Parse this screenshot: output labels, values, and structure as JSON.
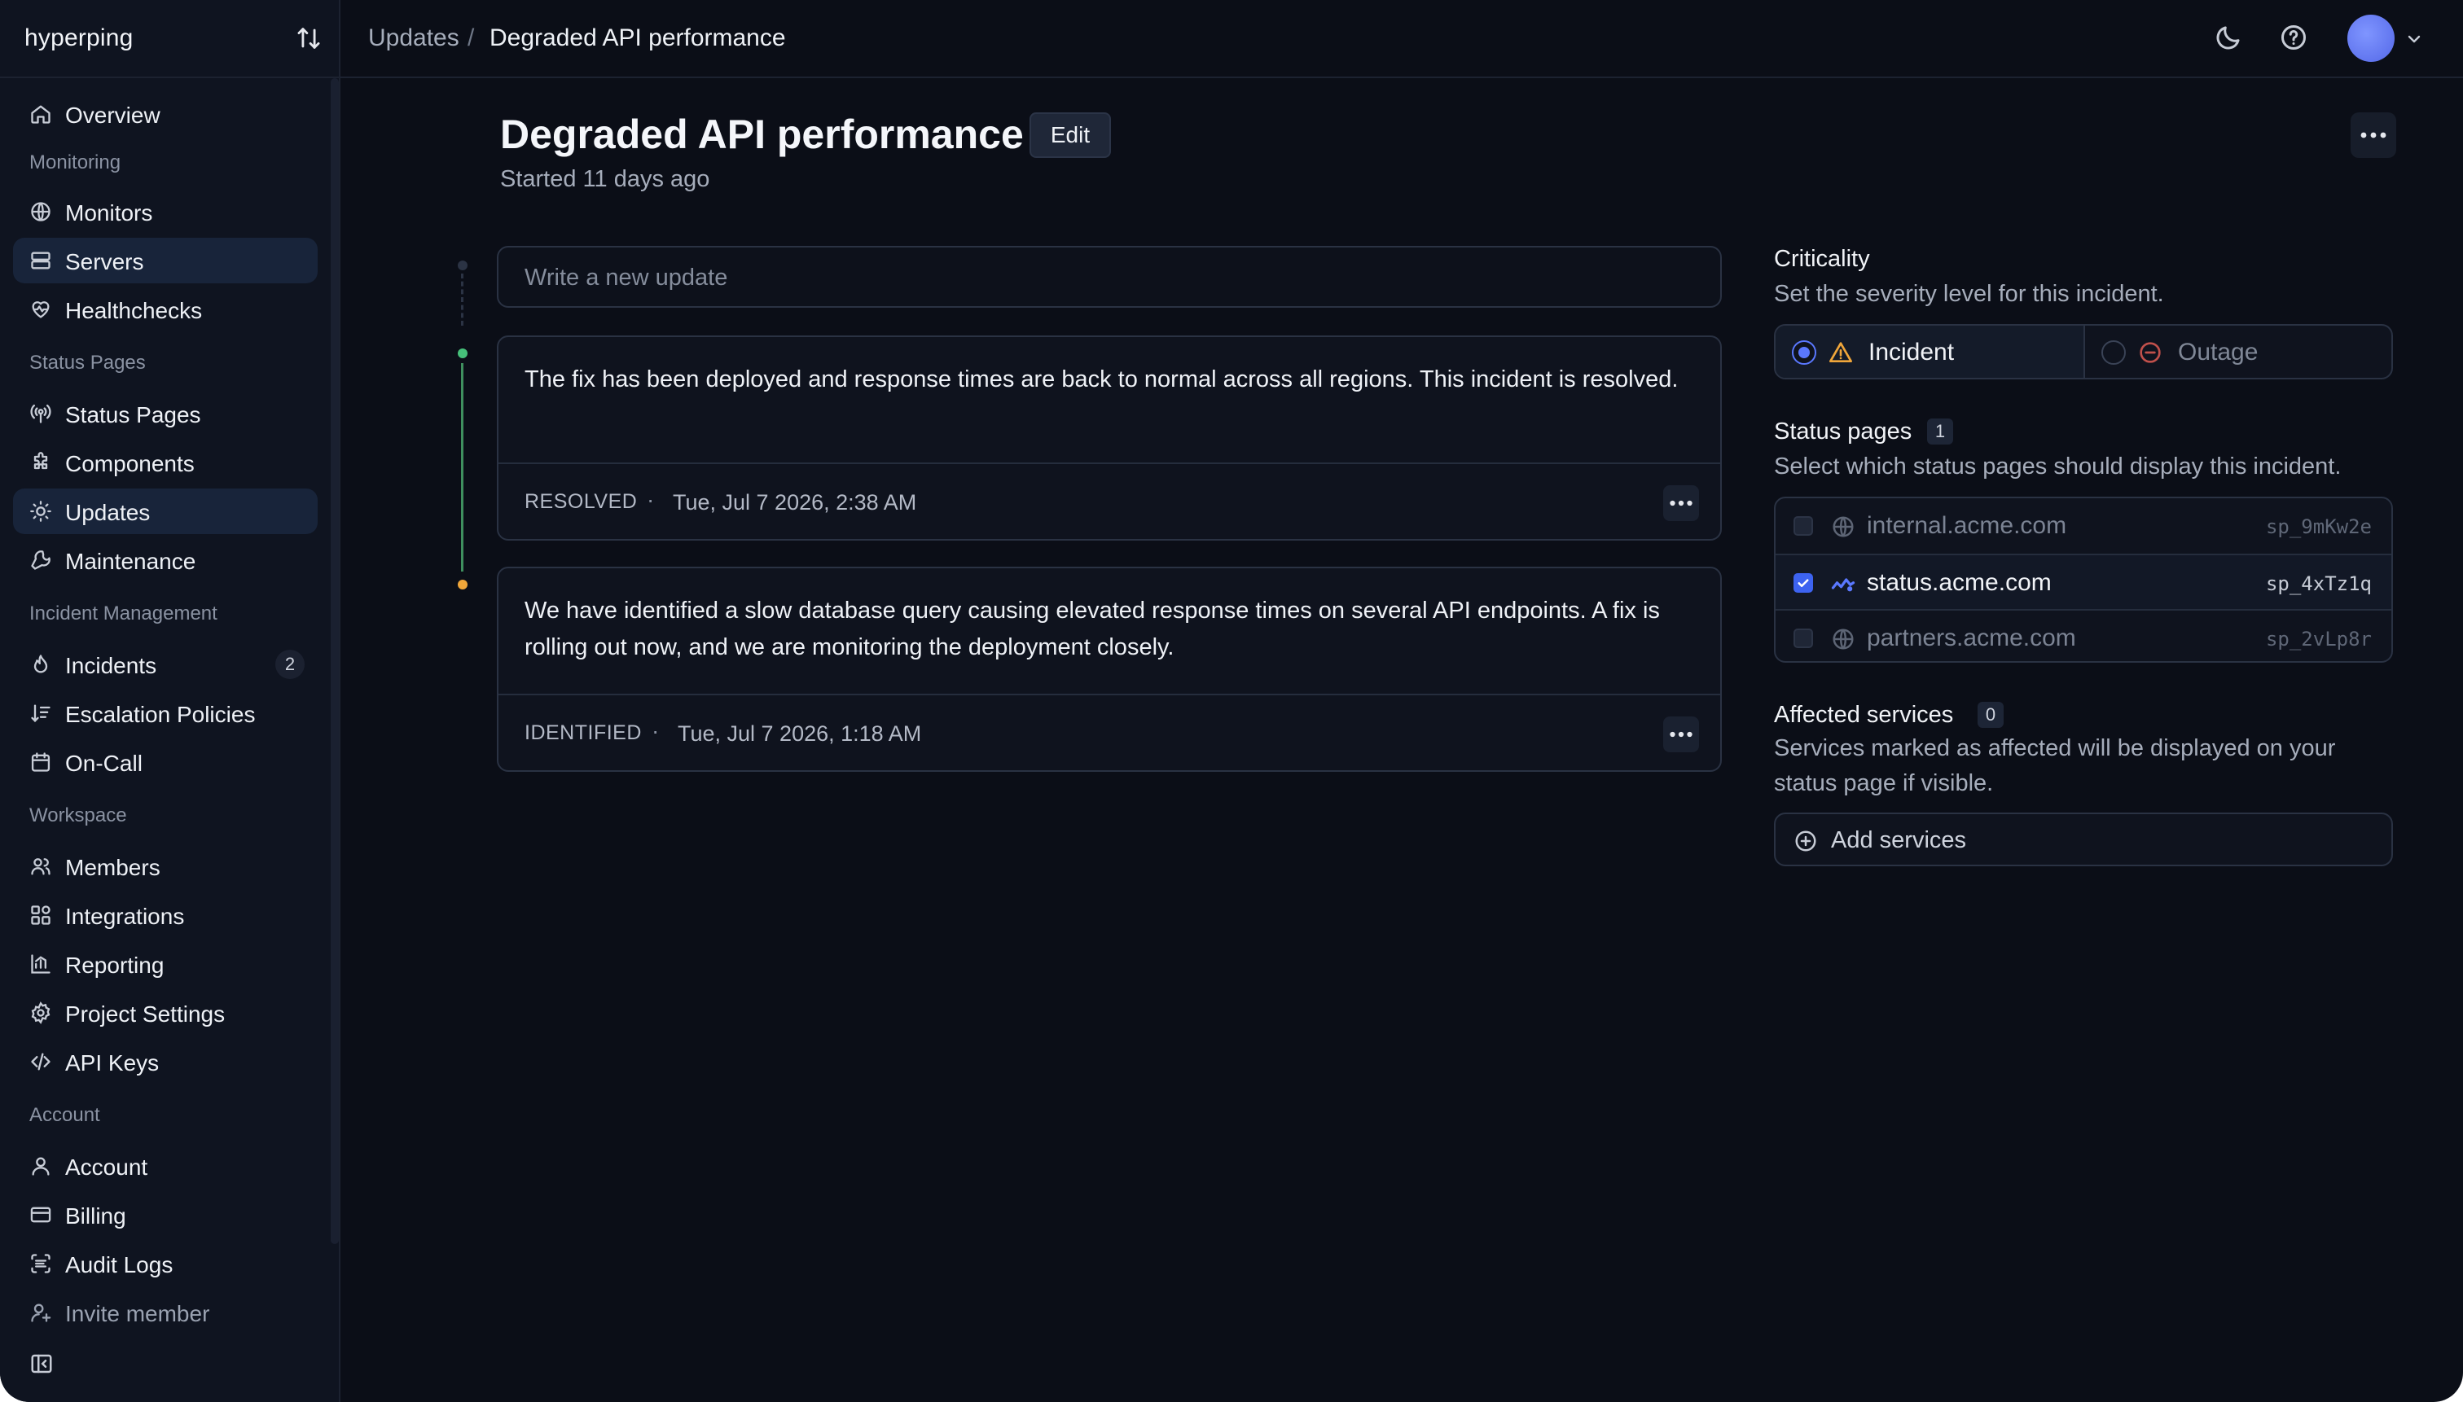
{
  "app": {
    "name": "hyperping"
  },
  "breadcrumb": {
    "parent": "Updates",
    "separator": "/",
    "current": "Degraded API performance"
  },
  "sidebar": {
    "items": [
      {
        "label": "Overview"
      },
      {
        "section": "Monitoring"
      },
      {
        "label": "Monitors"
      },
      {
        "label": "Servers",
        "active": true
      },
      {
        "label": "Healthchecks"
      },
      {
        "section": "Status Pages"
      },
      {
        "label": "Status Pages"
      },
      {
        "label": "Components"
      },
      {
        "label": "Updates",
        "active": true
      },
      {
        "label": "Maintenance"
      },
      {
        "section": "Incident Management"
      },
      {
        "label": "Incidents",
        "count": "2"
      },
      {
        "label": "Escalation Policies"
      },
      {
        "label": "On-Call"
      },
      {
        "section": "Workspace"
      },
      {
        "label": "Members"
      },
      {
        "label": "Integrations"
      },
      {
        "label": "Reporting"
      },
      {
        "label": "Project Settings"
      },
      {
        "label": "API Keys"
      },
      {
        "section": "Account"
      },
      {
        "label": "Account"
      },
      {
        "label": "Billing"
      },
      {
        "label": "Audit Logs"
      },
      {
        "label": "Invite member"
      }
    ]
  },
  "icons": {
    "switch": "arrow-up-down-icon",
    "theme": "moon-icon",
    "help": "help-circle-icon",
    "avatar_menu": "chevron-down-icon",
    "collapse": "sidebar-collapse-icon"
  },
  "incident": {
    "title": "Degraded API performance",
    "edit_label": "Edit",
    "started": "Started 11 days ago"
  },
  "composer": {
    "placeholder": "Write a new update"
  },
  "updates": [
    {
      "body": "The fix has been deployed and response times are back to normal across all regions. This incident is resolved.",
      "status": "RESOLVED",
      "separator": "·",
      "timestamp": "Tue, Jul 7 2026, 2:38 AM",
      "dot_color": "#46c07a"
    },
    {
      "body": "We have identified a slow database query causing elevated response times on several API endpoints. A fix is rolling out now, and we are monitoring the deployment closely.",
      "status": "IDENTIFIED",
      "separator": "·",
      "timestamp": "Tue, Jul 7 2026, 1:18 AM",
      "dot_color": "#f0a63a"
    }
  ],
  "criticality": {
    "title": "Criticality",
    "description": "Set the severity level for this incident.",
    "options": [
      {
        "label": "Incident",
        "selected": true,
        "icon": "warning-triangle-icon",
        "color": "#f0a63a"
      },
      {
        "label": "Outage",
        "selected": false,
        "icon": "minus-circle-icon",
        "color": "#d9534f"
      }
    ]
  },
  "status_pages": {
    "title": "Status pages",
    "count": "1",
    "description": "Select which status pages should display this incident.",
    "pages": [
      {
        "name": "internal.acme.com",
        "id": "sp_9mKw2e",
        "checked": false,
        "icon": "globe-icon"
      },
      {
        "name": "status.acme.com",
        "id": "sp_4xTz1q",
        "checked": true,
        "icon": "activity-icon"
      },
      {
        "name": "partners.acme.com",
        "id": "sp_2vLp8r",
        "checked": false,
        "icon": "globe-icon"
      }
    ]
  },
  "affected_services": {
    "title": "Affected services",
    "count": "0",
    "description": "Services marked as affected will be displayed on your status page if visible.",
    "add_label": "Add services"
  },
  "colors": {
    "background": "#0b0e17",
    "sidebar": "#0f1420",
    "active_nav": "#18243a",
    "accent": "#4f6bff"
  }
}
